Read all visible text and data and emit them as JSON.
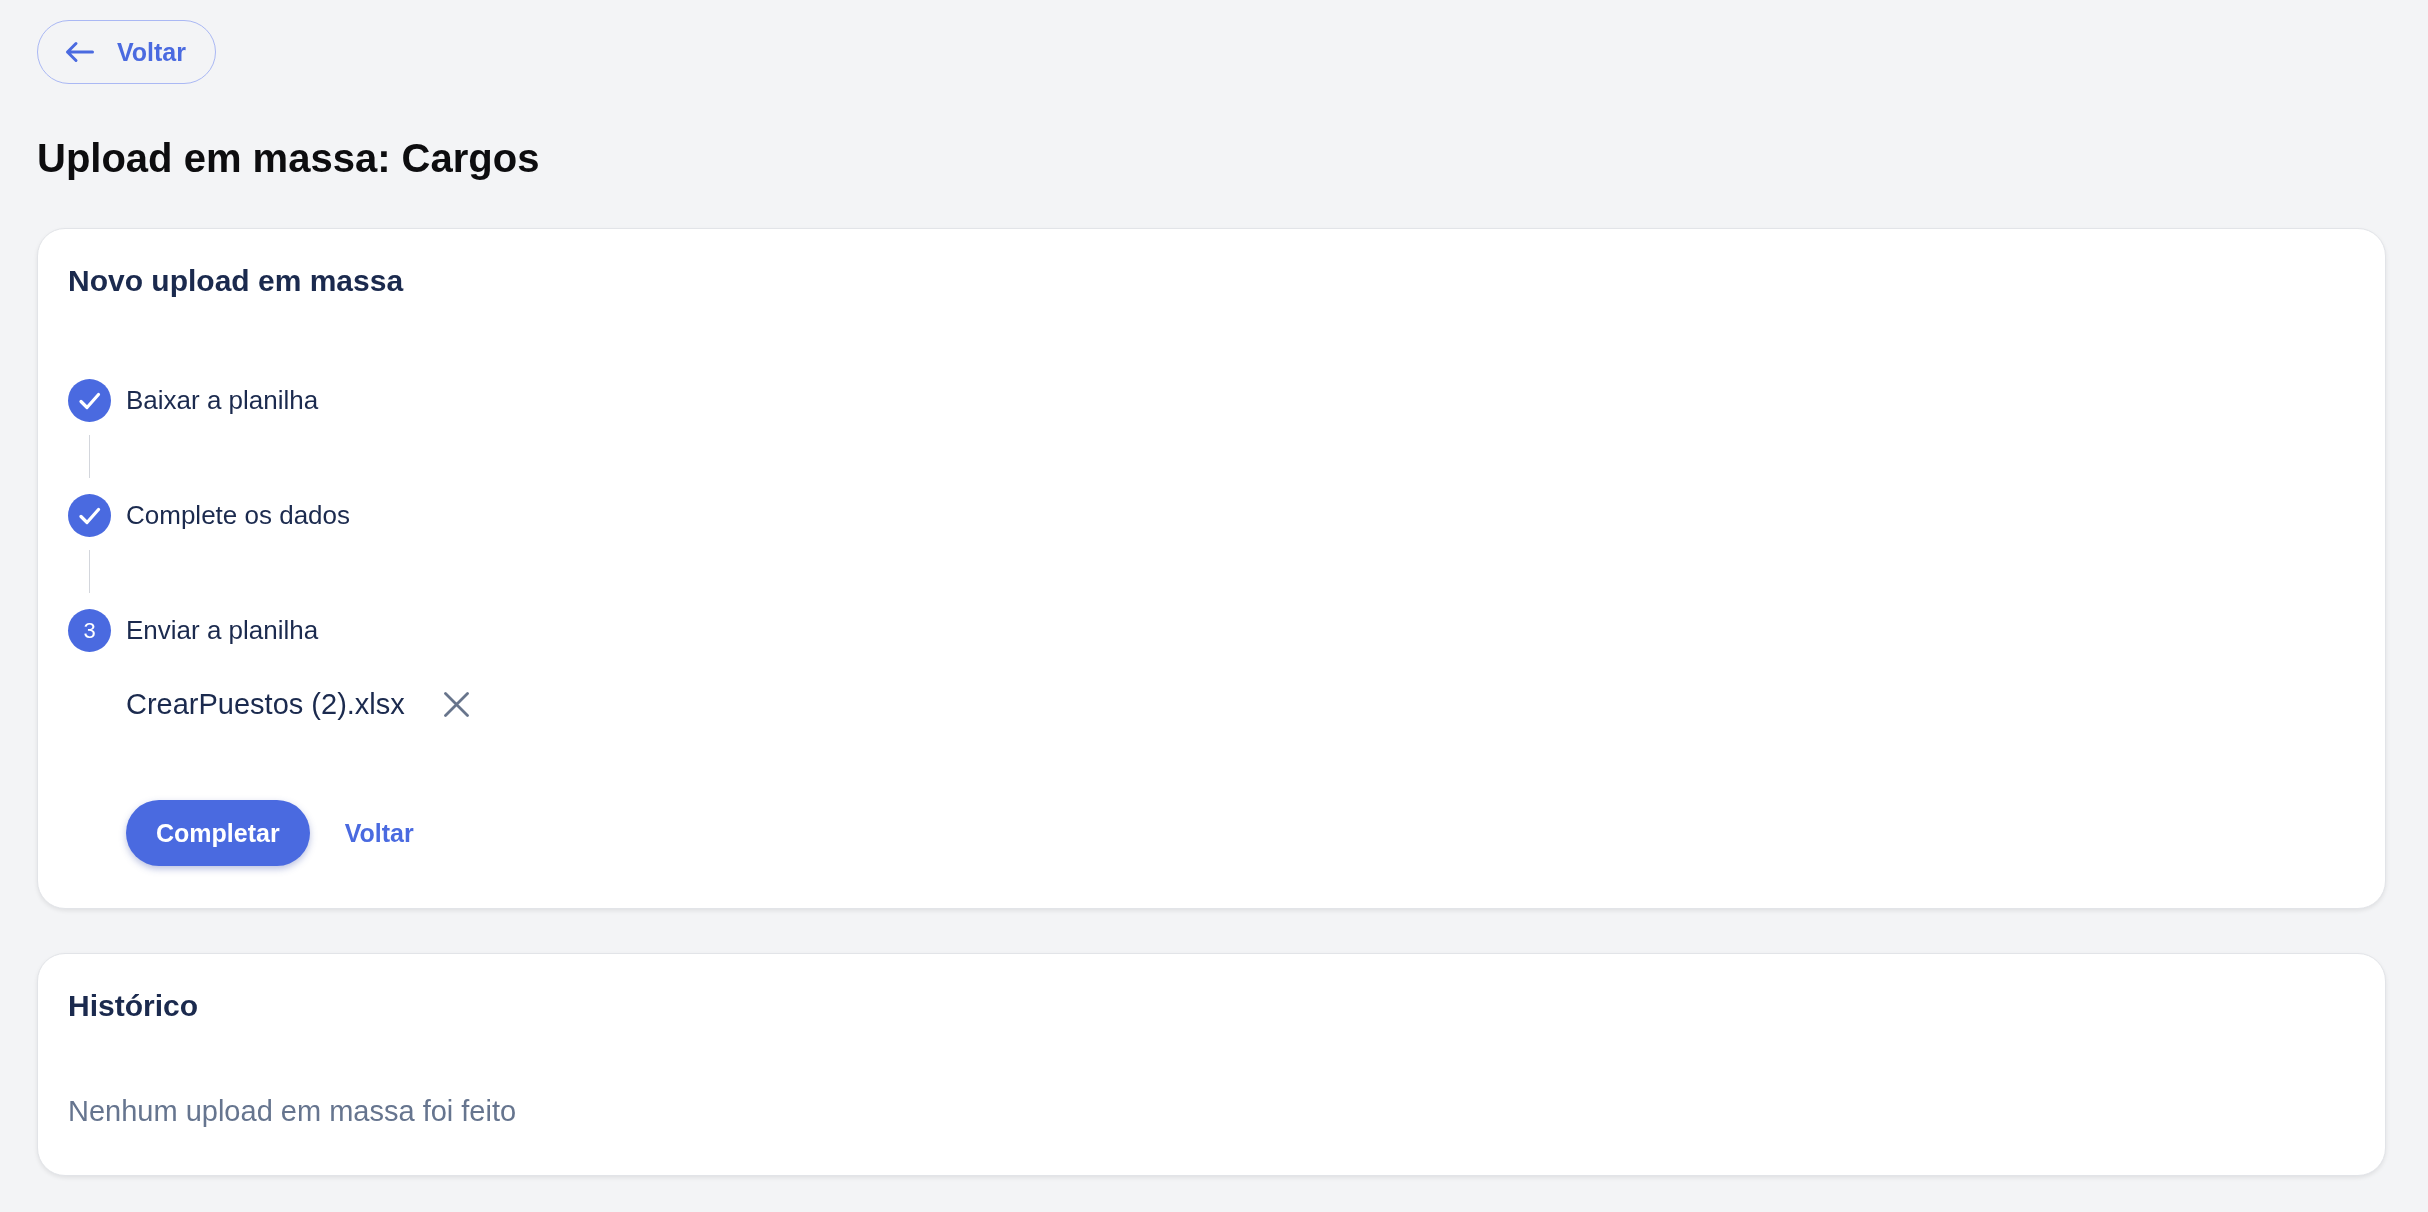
{
  "back_button": {
    "label": "Voltar"
  },
  "page_title": "Upload em massa: Cargos",
  "upload_card": {
    "title": "Novo upload em massa",
    "steps": [
      {
        "label": "Baixar a planilha",
        "completed": true
      },
      {
        "label": "Complete os dados",
        "completed": true
      },
      {
        "label": "Enviar a planilha",
        "completed": false,
        "number": "3"
      }
    ],
    "file": {
      "name": "CrearPuestos (2).xlsx"
    },
    "actions": [
      {
        "label": "Completar",
        "kind": "primary"
      },
      {
        "label": "Voltar",
        "kind": "link"
      }
    ]
  },
  "history_card": {
    "title": "Histórico",
    "empty_message": "Nenhum upload em massa foi feito"
  }
}
